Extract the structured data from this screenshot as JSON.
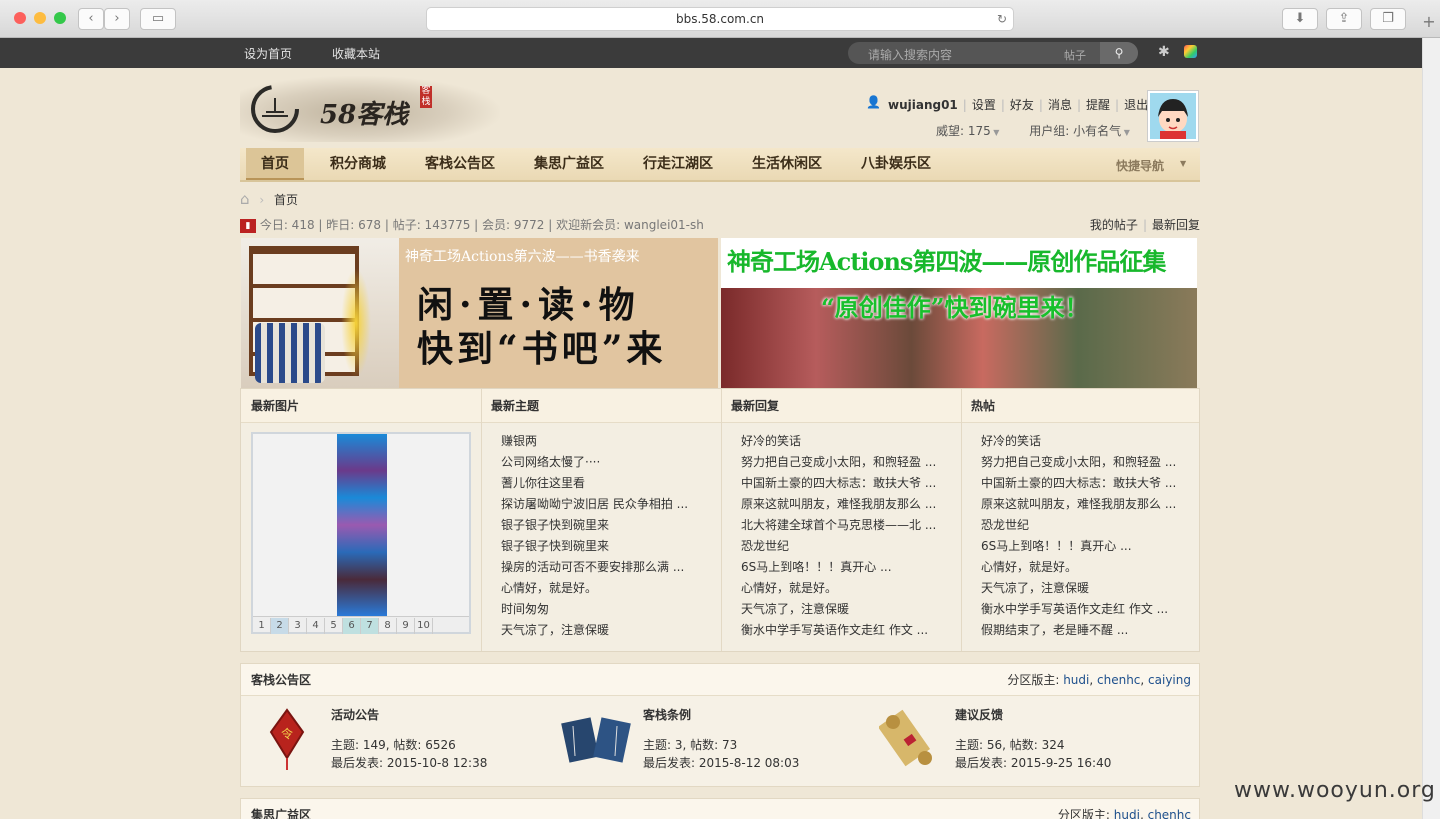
{
  "browser": {
    "url": "bbs.58.com.cn"
  },
  "topbar": {
    "links": [
      "设为首页",
      "收藏本站"
    ],
    "search_placeholder": "请输入搜索内容",
    "search_scope": "帖子"
  },
  "header": {
    "logo_text": "58客栈",
    "logo_stamp": "客栈",
    "username": "wujiang01",
    "user_links": [
      "设置",
      "好友",
      "消息",
      "提醒",
      "退出"
    ],
    "prestige": "威望: 175",
    "usergroup": "用户组: 小有名气"
  },
  "nav": {
    "items": [
      "首页",
      "积分商城",
      "客栈公告区",
      "集思广益区",
      "行走江湖区",
      "生活休闲区",
      "八卦娱乐区"
    ],
    "quick_nav": "快捷导航"
  },
  "breadcrumb": {
    "home": "首页"
  },
  "stats": {
    "text": "今日: 418 | 昨日: 678 | 帖子: 143775 | 会员: 9772 | 欢迎新会员: wanglei01-sh",
    "links": [
      "我的帖子",
      "最新回复"
    ]
  },
  "banners": {
    "left_top": "神奇工场Actions第六波——书香袭来",
    "left_l1": "闲·置·读·物",
    "left_l2": "快到“书吧”来",
    "right_top": "神奇工场Actions第四波——原创作品征集",
    "right_l2": "“原创佳作”快到碗里来！"
  },
  "columns": {
    "pics": {
      "title": "最新图片",
      "pages": [
        "1",
        "2",
        "3",
        "4",
        "5",
        "6",
        "7",
        "8",
        "9",
        "10"
      ]
    },
    "topics": {
      "title": "最新主题",
      "items": [
        "赚银两",
        "公司网络太慢了····",
        "蓍儿你往这里看",
        "探访屠呦呦宁波旧居 民众争相拍 ...",
        "银子银子快到碗里来",
        "银子银子快到碗里来",
        "操房的活动可否不要安排那么满 ...",
        "心情好，就是好。",
        "时间匆匆",
        "天气凉了，注意保暖"
      ]
    },
    "replies": {
      "title": "最新回复",
      "items": [
        "好冷的笑话",
        "努力把自己变成小太阳，和煦轻盈 ...",
        "中国新土豪的四大标志：敢扶大爷 ...",
        "原来这就叫朋友，难怪我朋友那么 ...",
        "北大将建全球首个马克思楼——北 ...",
        "恐龙世纪",
        "6S马上到咯！！！真开心 ...",
        "心情好，就是好。",
        "天气凉了，注意保暖",
        "衡水中学手写英语作文走红 作文 ..."
      ]
    },
    "hot": {
      "title": "热帖",
      "items": [
        "好冷的笑话",
        "努力把自己变成小太阳，和煦轻盈 ...",
        "中国新土豪的四大标志：敢扶大爷 ...",
        "原来这就叫朋友，难怪我朋友那么 ...",
        "恐龙世纪",
        "6S马上到咯！！！真开心 ...",
        "心情好，就是好。",
        "天气凉了，注意保暖",
        "衡水中学手写英语作文走红 作文 ...",
        "假期结束了，老是睡不醒 ..."
      ]
    }
  },
  "section1": {
    "title": "客栈公告区",
    "moderators_label": "分区版主:",
    "moderators": [
      "hudi",
      "chenhc",
      "caiying"
    ],
    "forums": [
      {
        "name": "活动公告",
        "stats": "主题: 149, 帖数: 6526",
        "last": "最后发表: 2015-10-8 12:38"
      },
      {
        "name": "客栈条例",
        "stats": "主题: 3, 帖数: 73",
        "last": "最后发表: 2015-8-12 08:03"
      },
      {
        "name": "建议反馈",
        "stats": "主题: 56, 帖数: 324",
        "last": "最后发表: 2015-9-25 16:40"
      }
    ]
  },
  "section2": {
    "title": "集思广益区",
    "moderators_label": "分区版主:",
    "moderators": [
      "hudi",
      "chenhc"
    ]
  },
  "watermark": "www.wooyun.org"
}
